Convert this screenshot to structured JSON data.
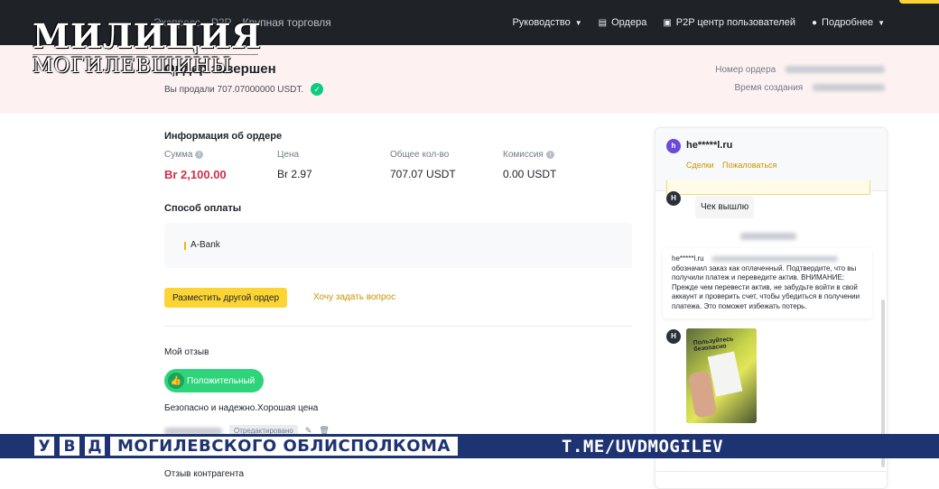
{
  "nav": {
    "left_item_1": "Экспресс",
    "left_item_2": "P2P",
    "left_item_3": "Крупная торговля",
    "guide": "Руководство",
    "orders": "Ордера",
    "p2p_center": "P2P центр пользователей",
    "more": "Подробнее"
  },
  "watermark": {
    "line1": "МИЛИЦИЯ",
    "line2": "МОГИЛЕВЩИНЫ"
  },
  "order": {
    "status": "Ордер завершен",
    "sold_text": "Вы продали 707.07000000 USDT.",
    "number_label": "Номер ордера",
    "time_label": "Время создания"
  },
  "info": {
    "title": "Информация об ордере",
    "amount_label": "Сумма",
    "amount_value": "Br 2,100.00",
    "price_label": "Цена",
    "price_value": "Br 2.97",
    "qty_label": "Общее кол-во",
    "qty_value": "707.07 USDT",
    "fee_label": "Комиссия",
    "fee_value": "0.00 USDT"
  },
  "payment": {
    "title": "Способ оплаты",
    "method": "A-Bank"
  },
  "actions": {
    "place_order": "Разместить другой ордер",
    "ask": "Хочу задать вопрос"
  },
  "review": {
    "title": "Мой отзыв",
    "positive": "Положительный",
    "text": "Безопасно и надежно.Хорошая цена",
    "edited": "Отредактировано",
    "counterparty_title": "Отзыв контрагента"
  },
  "chat": {
    "avatar_letter": "h",
    "user": "he*****l.ru",
    "tab_deals": "Сделки",
    "tab_complain": "Пожаловаться",
    "msg_avatar": "H",
    "message1": "Чек вышлю",
    "sys_user": "he*****l.ru",
    "sys_text": "обозначил заказ как оплаченный. Подтвердите, что вы получили платеж и переведите актив. ВНИМАНИЕ: Прежде чем перевести актив, не забудьте войти в свой аккаунт и проверить счет, чтобы убедиться в получении платежа. Это поможет избежать потерь.",
    "photo_caption": "Пользуйтесь безопасно"
  },
  "banner": {
    "letters": [
      "У",
      "В",
      "Д"
    ],
    "title": "МОГИЛЕВСКОГО ОБЛИСПОЛКОМА",
    "site": "T.ME/UVDMOGILEV"
  },
  "colors": {
    "nav_bg": "#1f2328",
    "accent_yellow": "#fcd535",
    "amount_red": "#cf304a",
    "positive_green": "#2ed47a",
    "banner_blue": "#1e3372"
  }
}
